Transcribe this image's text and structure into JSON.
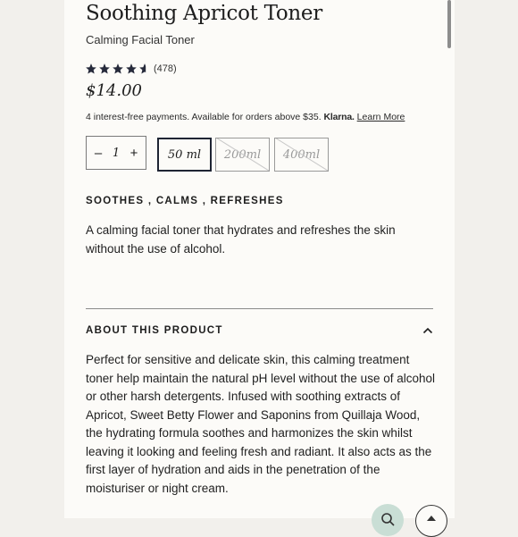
{
  "product": {
    "title": "Soothing Apricot Toner",
    "subtitle": "Calming Facial Toner",
    "rating": {
      "stars": 4.5,
      "count_text": "(478)"
    },
    "price": "$14.00"
  },
  "installments": {
    "text": "4 interest-free payments. Available for orders above $35.",
    "brand": "Klarna.",
    "link": "Learn More"
  },
  "quantity": {
    "minus": "–",
    "value": "1",
    "plus": "+"
  },
  "sizes": [
    {
      "label": "50 ml",
      "state": "selected"
    },
    {
      "label": "200ml",
      "state": "unavailable"
    },
    {
      "label": "400ml",
      "state": "unavailable"
    }
  ],
  "tagline": "SOOTHES , CALMS , REFRESHES",
  "short_description": "A calming facial toner that hydrates and refreshes the skin without the use of alcohol.",
  "about": {
    "title": "ABOUT THIS PRODUCT",
    "expanded": true,
    "body": "Perfect for sensitive and delicate skin, this calming treatment toner help maintain the natural pH level without the use of alcohol or other harsh detergents. Infused with soothing extracts of Apricot, Sweet Betty Flower and Saponins from Quillaja Wood, the hydrating formula soothes and harmonizes the skin whilst leaving it looking and feeling fresh and radiant. It also acts as the first layer of hydration and aids in the penetration of the moisturiser or night cream."
  },
  "icons": {
    "star": "star-icon",
    "chevron": "chevron-up-icon",
    "search": "search-icon",
    "top": "arrow-up-icon"
  },
  "colors": {
    "page_bg": "#f2f0ec",
    "panel_bg": "#fcfbf8",
    "star": "#262a3b",
    "selected_border": "#1e2433",
    "search_fab": "#c9ded5"
  }
}
